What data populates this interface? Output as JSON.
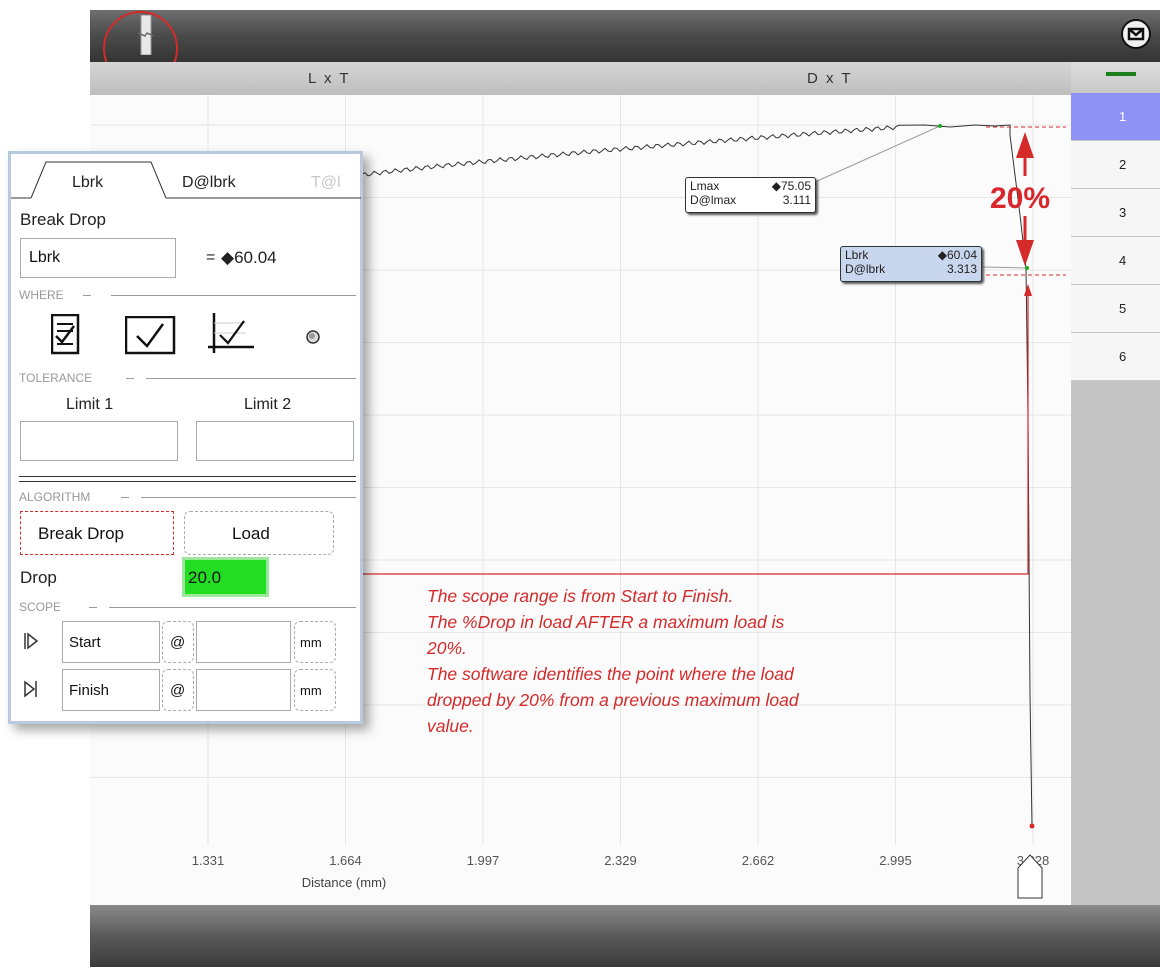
{
  "header": {
    "left_title": "L x T",
    "right_title": "D x T"
  },
  "sidebar": {
    "items": [
      "1",
      "2",
      "3",
      "4",
      "5",
      "6"
    ],
    "active": "1"
  },
  "chart": {
    "xlabel": "Distance (mm)",
    "xticks": [
      "1.331",
      "1.664",
      "1.997",
      "2.329",
      "2.662",
      "2.995",
      "3.328"
    ]
  },
  "chart_data": {
    "type": "line",
    "xlabel": "Distance (mm)",
    "ylabel": "",
    "x_ticks": [
      1.331,
      1.664,
      1.997,
      2.329,
      2.662,
      2.995,
      3.328
    ],
    "annotations": [
      {
        "label": "Lmax",
        "value": "75.05",
        "label2": "D@lmax",
        "value2": "3.111"
      },
      {
        "label": "Lbrk",
        "value": "60.04",
        "label2": "D@lbrk",
        "value2": "3.313"
      }
    ],
    "drop_percent_label": "20%"
  },
  "infobox_lmax": {
    "l1": "Lmax",
    "v1": "75.05",
    "l2": "D@lmax",
    "v2": "3.111"
  },
  "infobox_lbrk": {
    "l1": "Lbrk",
    "v1": "60.04",
    "l2": "D@lbrk",
    "v2": "3.313"
  },
  "drop_label": "20%",
  "note": [
    "The scope range is from Start to Finish.",
    "The %Drop in load AFTER a maximum load is",
    "20%.",
    "The software identifies the point where the load",
    "dropped by 20% from a previous maximum load",
    "value."
  ],
  "panel": {
    "tabs": [
      "Lbrk",
      "D@lbrk",
      "T@l"
    ],
    "title": "Break Drop",
    "name_field": "Lbrk",
    "equals": "=",
    "result_value": "60.04",
    "where_label": "WHERE",
    "tolerance_label": "TOLERANCE",
    "limit1_label": "Limit 1",
    "limit2_label": "Limit 2",
    "algorithm_label": "ALGORITHM",
    "algo_option1": "Break Drop",
    "algo_option2": "Load",
    "drop_label": "Drop",
    "drop_value": "20.0",
    "scope_label": "SCOPE",
    "start_label": "Start",
    "finish_label": "Finish",
    "at_symbol": "@",
    "unit": "mm"
  },
  "colors": {
    "accent_red": "#d42a2a",
    "active_blue": "#8e92f4",
    "drop_green": "#22dd22"
  }
}
